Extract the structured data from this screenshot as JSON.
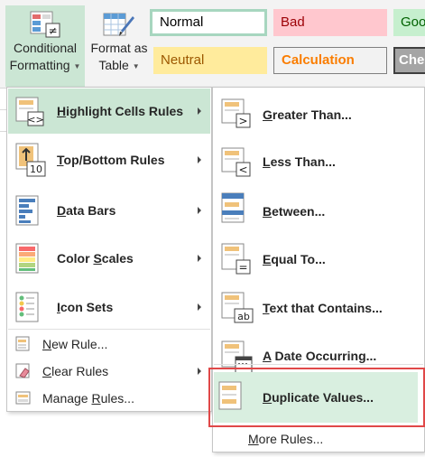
{
  "ribbon": {
    "conditional_formatting": {
      "line1": "Conditional",
      "line2": "Formatting"
    },
    "format_as_table": {
      "line1": "Format as",
      "line2": "Table"
    },
    "cell_styles": [
      {
        "label": "Normal"
      },
      {
        "label": "Bad"
      },
      {
        "label": "Goo"
      },
      {
        "label": "Neutral"
      },
      {
        "label": "Calculation"
      },
      {
        "label": "Che"
      }
    ]
  },
  "menu": {
    "highlight_cells_rules": {
      "mnemonic": "H",
      "rest": "ighlight Cells Rules"
    },
    "top_bottom_rules": {
      "mnemonic": "T",
      "rest": "op/Bottom Rules"
    },
    "data_bars": {
      "mnemonic": "D",
      "rest": "ata Bars"
    },
    "color_scales": {
      "prefix": "Color ",
      "mnemonic": "S",
      "rest": "cales"
    },
    "icon_sets": {
      "mnemonic": "I",
      "rest": "con Sets"
    },
    "new_rule": {
      "mnemonic": "N",
      "rest": "ew Rule..."
    },
    "clear_rules": {
      "mnemonic": "C",
      "rest": "lear Rules"
    },
    "manage_rules": {
      "prefix": "Manage ",
      "mnemonic": "R",
      "rest": "ules..."
    }
  },
  "submenu": {
    "greater_than": {
      "mnemonic": "G",
      "rest": "reater Than..."
    },
    "less_than": {
      "mnemonic": "L",
      "rest": "ess Than..."
    },
    "between": {
      "mnemonic": "B",
      "rest": "etween..."
    },
    "equal_to": {
      "mnemonic": "E",
      "rest": "qual To..."
    },
    "text_that_contains": {
      "mnemonic": "T",
      "rest": "ext that Contains..."
    },
    "a_date_occurring": {
      "mnemonic": "A",
      "rest": " Date Occurring..."
    },
    "duplicate_values": {
      "mnemonic": "D",
      "rest": "uplicate Values..."
    },
    "more_rules": {
      "mnemonic": "M",
      "rest": "ore Rules..."
    }
  },
  "icon_glyphs": {
    "greater_than": ">",
    "less_than": "<",
    "equal_to": "=",
    "text_contains": "ab",
    "top_bottom": "10",
    "not_equal": "≠"
  },
  "colors": {
    "menu_highlight": "#cbe6d4",
    "callout_border": "#e04848",
    "rule_bar": "#f0c27a"
  }
}
